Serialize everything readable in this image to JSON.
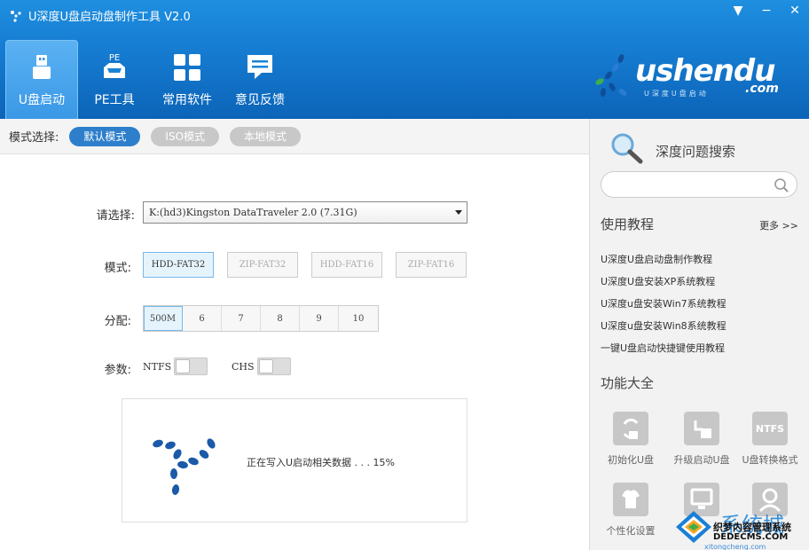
{
  "window": {
    "title": "U深度U盘启动盘制作工具 V2.0",
    "controls": [
      "▼",
      "−",
      "✕"
    ]
  },
  "nav": [
    {
      "label": "U盘启动",
      "icon": "usb-drive-icon",
      "active": true
    },
    {
      "label": "PE工具",
      "icon": "pe-tools-icon",
      "badge": "PE",
      "active": false
    },
    {
      "label": "常用软件",
      "icon": "apps-grid-icon",
      "active": false
    },
    {
      "label": "意见反馈",
      "icon": "feedback-chat-icon",
      "active": false
    }
  ],
  "brand": {
    "name": "ushendu",
    "domain": ".com",
    "tagline": "U深度U盘启动"
  },
  "mode_bar": {
    "label": "模式选择:",
    "modes": [
      "默认模式",
      "ISO模式",
      "本地模式"
    ],
    "selected": "默认模式"
  },
  "form": {
    "device_label": "请选择:",
    "device_value": "K:(hd3)Kingston DataTraveler 2.0 (7.31G)",
    "mode_label": "模式:",
    "formats": [
      "HDD-FAT32",
      "ZIP-FAT32",
      "HDD-FAT16",
      "ZIP-FAT16"
    ],
    "selected_format": "HDD-FAT32",
    "alloc_label": "分配:",
    "alloc_options": [
      "500M",
      "6",
      "7",
      "8",
      "9",
      "10"
    ],
    "selected_alloc": "500M",
    "param_label": "参数:",
    "ntfs_label": "NTFS",
    "chs_label": "CHS",
    "ntfs_on": false,
    "chs_on": false
  },
  "progress": {
    "text": "正在写入U启动相关数据 . . . 15%",
    "percent": 15
  },
  "sidebar": {
    "search_title": "深度问题搜索",
    "search_value": "",
    "tutorials_title": "使用教程",
    "more_label": "更多 >>",
    "tutorials": [
      "U深度U盘启动盘制作教程",
      "U深度U盘安装XP系统教程",
      "U深度u盘安装Win7系统教程",
      "U深度u盘安装Win8系统教程",
      "一键U盘启动快捷键使用教程"
    ],
    "features_title": "功能大全",
    "features": [
      {
        "label": "初始化U盘",
        "icon": "init-usb-icon"
      },
      {
        "label": "升级启动U盘",
        "icon": "upgrade-usb-icon"
      },
      {
        "label": "U盘转换格式",
        "icon": "ntfs-convert-icon",
        "icon_text": "NTFS"
      },
      {
        "label": "个性化设置",
        "icon": "personalize-icon"
      },
      {
        "label": "",
        "icon": "monitor-icon"
      },
      {
        "label": "",
        "icon": "user-icon"
      }
    ]
  },
  "watermark": {
    "big": "系统城",
    "line1": "织梦内容管理系统",
    "line2": "DEDECMS.COM",
    "line3": "xitongcheng.com"
  },
  "colors": {
    "header_blue": "#157bd0",
    "accent_blue": "#2e7fcb",
    "logo_dark_blue": "#0f4f9a"
  }
}
